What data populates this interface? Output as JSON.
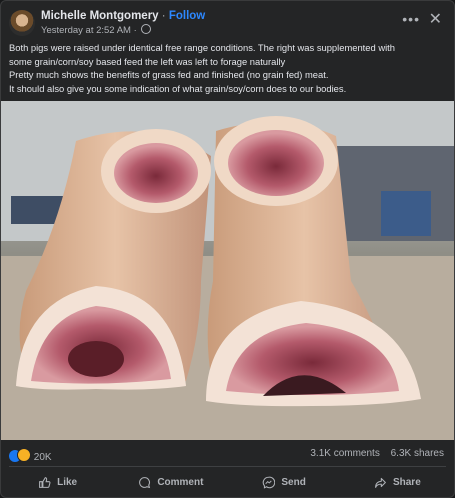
{
  "post": {
    "author": "Michelle Montgomery",
    "separator": "·",
    "follow_label": "Follow",
    "timestamp": "Yesterday at 2:52 AM",
    "dot": "·",
    "more_icon": "more-horizontal-icon",
    "close_icon": "close-icon",
    "body_lines": [
      "Both pigs were raised under identical free range conditions. The right was supplemented with",
      "some grain/corn/soy based feed the left was left to forage naturally",
      "Pretty much shows the benefits of grass fed and finished (no grain fed) meat.",
      "It should also give you some indication of what grain/soy/corn does to our bodies."
    ]
  },
  "stats": {
    "reaction_count": "20K",
    "comments": "3.1K comments",
    "shares": "6.3K shares",
    "reaction_icons": [
      "like-icon",
      "care-icon"
    ]
  },
  "actions": {
    "like": "Like",
    "comment": "Comment",
    "send": "Send",
    "share": "Share"
  },
  "colors": {
    "background": "#242526",
    "link": "#2d88ff",
    "text": "#e4e6eb",
    "muted": "#b0b3b8"
  }
}
